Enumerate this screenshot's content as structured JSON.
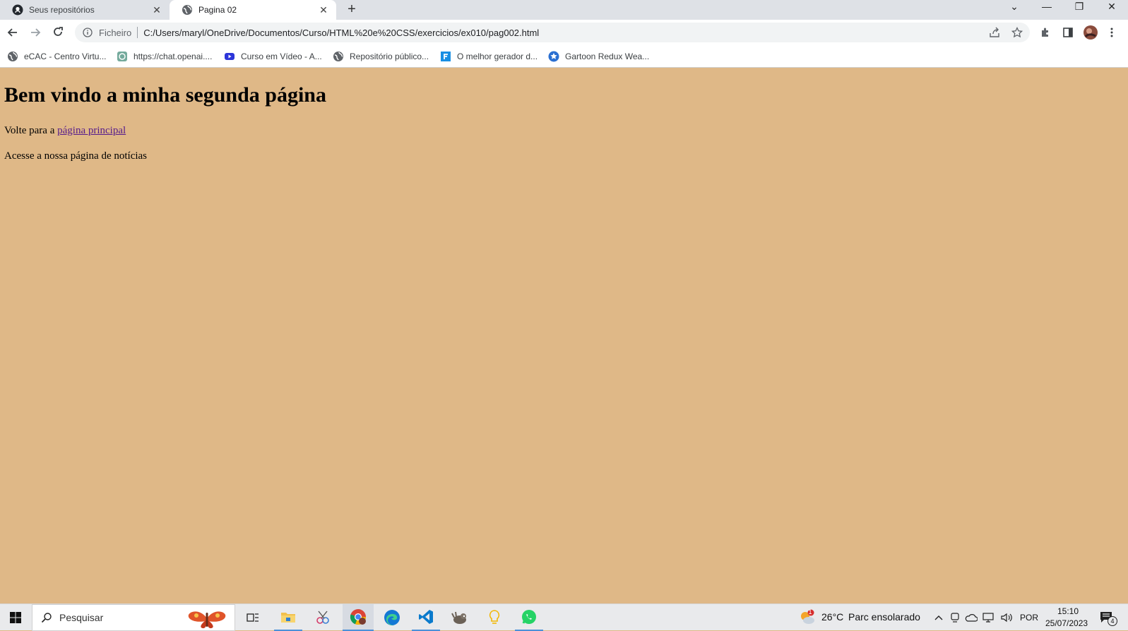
{
  "browser": {
    "tabs": [
      {
        "title": "Seus repositórios",
        "icon": "github-icon",
        "active": false
      },
      {
        "title": "Pagina 02",
        "icon": "globe-icon",
        "active": true
      }
    ],
    "new_tab_label": "+",
    "address": {
      "scheme_label": "Ficheiro",
      "url": "C:/Users/maryl/OneDrive/Documentos/Curso/HTML%20e%20CSS/exercicios/ex010/pag002.html"
    },
    "bookmarks": [
      {
        "label": "eCAC - Centro Virtu...",
        "icon": "globe-icon"
      },
      {
        "label": "https://chat.openai....",
        "icon": "openai-icon"
      },
      {
        "label": "Curso em Vídeo - A...",
        "icon": "youtube-icon"
      },
      {
        "label": "Repositório público...",
        "icon": "globe-icon"
      },
      {
        "label": "O melhor gerador d...",
        "icon": "f-icon"
      },
      {
        "label": "Gartoon Redux Wea...",
        "icon": "star-badge-icon"
      }
    ]
  },
  "page": {
    "heading": "Bem vindo a minha segunda página",
    "back_prefix": "Volte para a ",
    "back_link": "página principal",
    "news_text": "Acesse a nossa página de notícias",
    "background_color": "#dfb887"
  },
  "taskbar": {
    "search_placeholder": "Pesquisar",
    "weather_temp": "26°C",
    "weather_text": "Parc ensolarado",
    "weather_badge": "1",
    "language": "POR",
    "time": "15:10",
    "date": "25/07/2023",
    "notification_count": "4"
  }
}
